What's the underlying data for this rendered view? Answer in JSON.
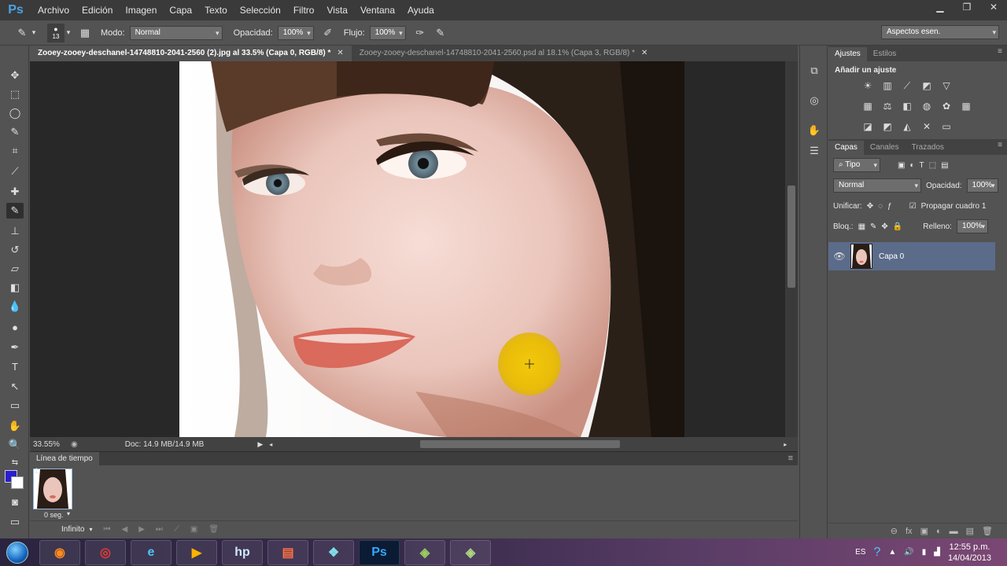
{
  "app": {
    "logo": "Ps"
  },
  "menu": [
    "Archivo",
    "Edición",
    "Imagen",
    "Capa",
    "Texto",
    "Selección",
    "Filtro",
    "Vista",
    "Ventana",
    "Ayuda"
  ],
  "options": {
    "brush_size": "13",
    "mode_label": "Modo:",
    "mode_value": "Normal",
    "opacity_label": "Opacidad:",
    "opacity_value": "100%",
    "flow_label": "Flujo:",
    "flow_value": "100%",
    "workspace": "Aspectos esen."
  },
  "tabs": [
    {
      "label": "Zooey-zooey-deschanel-14748810-2041-2560 (2).jpg al 33.5% (Capa 0, RGB/8) *"
    },
    {
      "label": "Zooey-zooey-deschanel-14748810-2041-2560.psd al 18.1% (Capa 3, RGB/8) *"
    }
  ],
  "status": {
    "zoom": "33.55%",
    "doc": "Doc: 14.9 MB/14.9 MB"
  },
  "timeline": {
    "title": "Línea de tiempo",
    "frame_number": "1",
    "frame_time": "0 seg.",
    "loop": "Infinito"
  },
  "right_panel": {
    "top_tabs": [
      "Ajustes",
      "Estilos"
    ],
    "adjust_title": "Añadir un ajuste",
    "layer_tabs": [
      "Capas",
      "Canales",
      "Trazados"
    ],
    "filter_kind": "Tipo",
    "blend_mode": "Normal",
    "opacity_label": "Opacidad:",
    "opacity_value": "100%",
    "unify_label": "Unificar:",
    "propagate_label": "Propagar cuadro 1",
    "lock_label": "Bloq.:",
    "fill_label": "Relleno:",
    "fill_value": "100%",
    "layer_name": "Capa 0"
  },
  "taskbar": {
    "lang": "ES",
    "time": "12:55 p.m.",
    "date": "14/04/2013"
  },
  "colors": {
    "foreground": "#2a1ed0",
    "background": "#ffffff",
    "layer_selected": "#5b6b8a"
  }
}
